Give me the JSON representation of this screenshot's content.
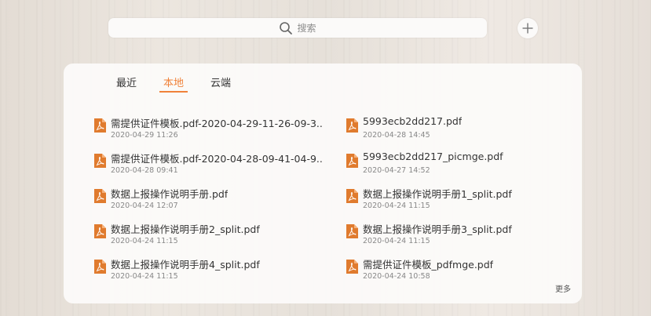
{
  "search": {
    "placeholder": "搜索",
    "icon": "search-icon"
  },
  "add_button": {
    "icon": "plus-icon"
  },
  "tabs": [
    {
      "label": "最近",
      "active": false
    },
    {
      "label": "本地",
      "active": true
    },
    {
      "label": "云端",
      "active": false
    }
  ],
  "files": [
    {
      "name": "需提供证件模板.pdf-2020-04-29-11-26-09-3...",
      "date": "2020-04-29 11:26"
    },
    {
      "name": "5993ecb2dd217.pdf",
      "date": "2020-04-28 14:45"
    },
    {
      "name": "需提供证件模板.pdf-2020-04-28-09-41-04-9...",
      "date": "2020-04-28 09:41"
    },
    {
      "name": "5993ecb2dd217_picmge.pdf",
      "date": "2020-04-27 14:52"
    },
    {
      "name": "数据上报操作说明手册.pdf",
      "date": "2020-04-24 12:07"
    },
    {
      "name": "数据上报操作说明手册1_split.pdf",
      "date": "2020-04-24 11:15"
    },
    {
      "name": "数据上报操作说明手册2_split.pdf",
      "date": "2020-04-24 11:15"
    },
    {
      "name": "数据上报操作说明手册3_split.pdf",
      "date": "2020-04-24 11:15"
    },
    {
      "name": "数据上报操作说明手册4_split.pdf",
      "date": "2020-04-24 11:15"
    },
    {
      "name": "需提供证件模板_pdfmge.pdf",
      "date": "2020-04-24 10:58"
    }
  ],
  "more_label": "更多",
  "colors": {
    "accent": "#f0823a",
    "pdf_icon": "#e07b2e"
  }
}
